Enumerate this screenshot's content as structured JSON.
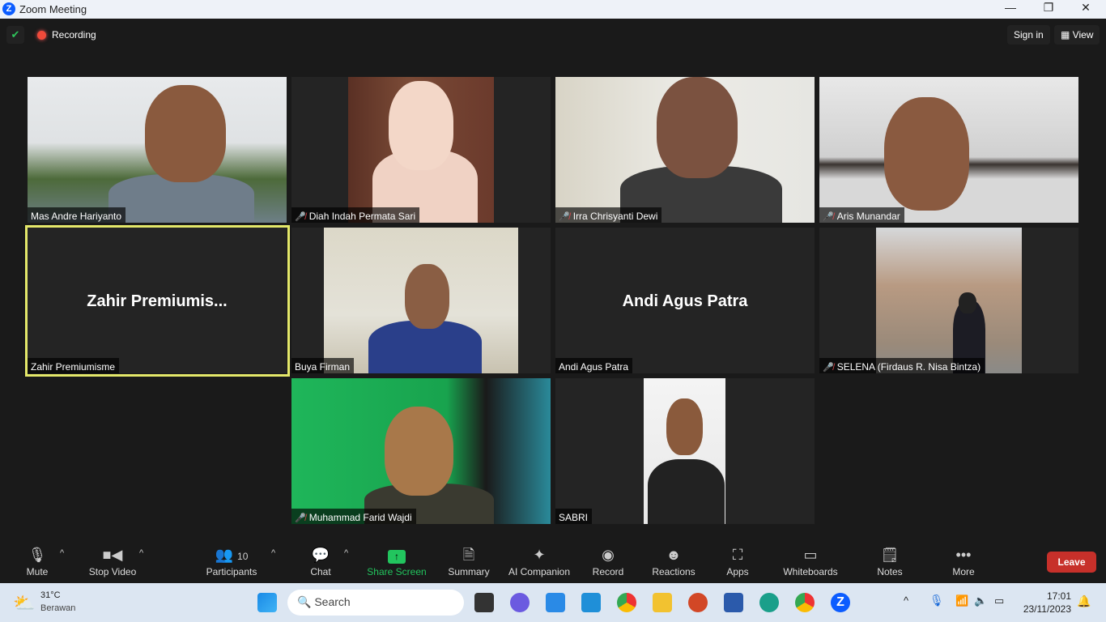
{
  "window": {
    "title": "Zoom Meeting",
    "minimize": "—",
    "maximize": "❐",
    "close": "✕"
  },
  "topbar": {
    "recording": "Recording",
    "sign_in": "Sign in",
    "view": "View"
  },
  "tiles": [
    {
      "name": "Mas Andre Hariyanto",
      "muted": false
    },
    {
      "name": "Diah Indah Permata Sari",
      "muted": true
    },
    {
      "name": "Irra Chrisyanti Dewi",
      "muted": true
    },
    {
      "name": "Aris Munandar",
      "muted": true
    },
    {
      "name": "Zahir Premiumisme",
      "display": "Zahir  Premiumis...",
      "muted": false,
      "video": false,
      "active": true
    },
    {
      "name": "Buya Firman",
      "muted": false
    },
    {
      "name": "Andi Agus Patra",
      "display": "Andi Agus Patra",
      "muted": false,
      "video": false
    },
    {
      "name": "SELENA (Firdaus R. Nisa Bintza)",
      "muted": true
    },
    {
      "name": "Muhammad Farid Wajdi",
      "muted": true
    },
    {
      "name": "SABRI",
      "muted": false
    }
  ],
  "toolbar": {
    "mute": "Mute",
    "stop_video": "Stop Video",
    "participants": "Participants",
    "participants_count": "10",
    "chat": "Chat",
    "share_screen": "Share Screen",
    "summary": "Summary",
    "ai_companion": "AI Companion",
    "record": "Record",
    "reactions": "Reactions",
    "apps": "Apps",
    "whiteboards": "Whiteboards",
    "notes": "Notes",
    "more": "More",
    "leave": "Leave",
    "share_color": "#22c55e",
    "leave_color": "#c7302a"
  },
  "taskbar": {
    "temp": "31°C",
    "weather": "Berawan",
    "search": "Search",
    "time": "17:01",
    "date": "23/11/2023"
  }
}
